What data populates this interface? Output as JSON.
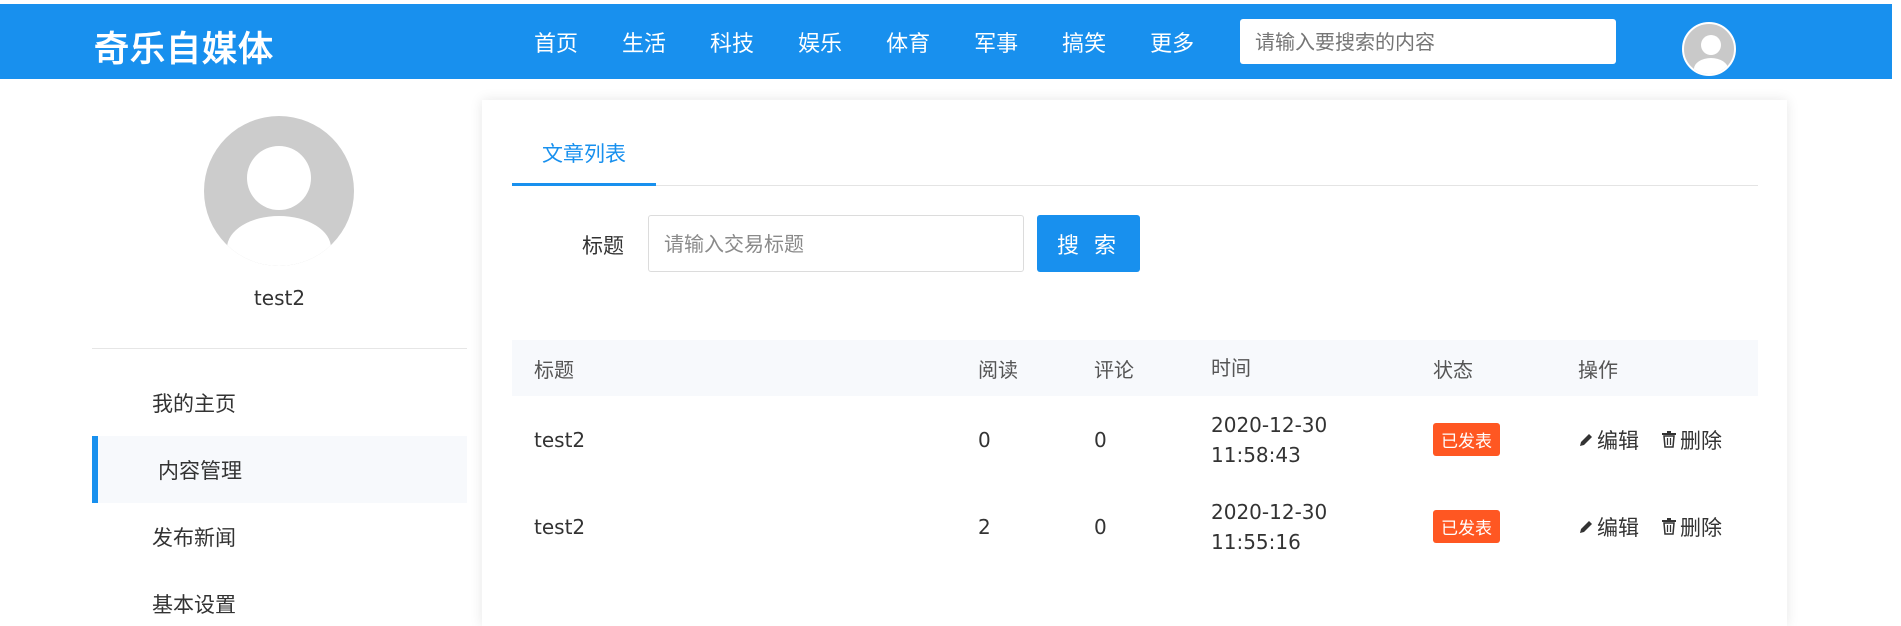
{
  "header": {
    "logo": "奇乐自媒体",
    "nav": [
      "首页",
      "生活",
      "科技",
      "娱乐",
      "体育",
      "军事",
      "搞笑",
      "更多"
    ],
    "search_placeholder": "请输入要搜索的内容"
  },
  "sidebar": {
    "username": "test2",
    "items": [
      {
        "label": "我的主页",
        "active": false
      },
      {
        "label": "内容管理",
        "active": true
      },
      {
        "label": "发布新闻",
        "active": false
      },
      {
        "label": "基本设置",
        "active": false
      }
    ]
  },
  "main": {
    "tab": "文章列表",
    "filter": {
      "label": "标题",
      "placeholder": "请输入交易标题",
      "button": "搜 索"
    },
    "table": {
      "headers": [
        "标题",
        "阅读",
        "评论",
        "时间",
        "状态",
        "操作"
      ],
      "rows": [
        {
          "title": "test2",
          "reads": "0",
          "comments": "0",
          "date": "2020-12-30",
          "time": "11:58:43",
          "status": "已发表",
          "edit": "编辑",
          "delete": "删除"
        },
        {
          "title": "test2",
          "reads": "2",
          "comments": "0",
          "date": "2020-12-30",
          "time": "11:55:16",
          "status": "已发表",
          "edit": "编辑",
          "delete": "删除"
        }
      ]
    }
  },
  "colors": {
    "primary": "#1890ee",
    "badge": "#ff5722"
  },
  "icons": [
    "user-avatar-icon",
    "pencil-icon",
    "trash-icon"
  ]
}
